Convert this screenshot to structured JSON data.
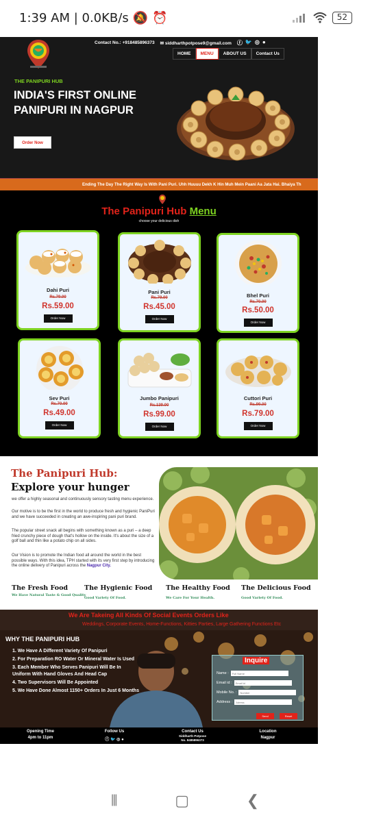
{
  "status": {
    "time": "1:39 AM | 0.0KB/s",
    "battery": "52"
  },
  "header": {
    "contact": "Contact No.: +918485896373",
    "email": "siddharthpotpose9@gmail.com",
    "nav": [
      "HOME",
      "MENU",
      "ABOUT US",
      "Contact Us"
    ]
  },
  "hero": {
    "small": "THE PANIPURI HUB",
    "title": "INDIA'S FIRST ONLINE PANIPURI IN NAGPUR",
    "button": "Order Now"
  },
  "ticker": "Ending The Day The Right Way Is With Pani Puri. Uhh Huuuu Dekh K Hin Muh Mein Paani Aa Jata Hai. Bhaiya Th",
  "menu": {
    "title_a": "The Panipuri Hub",
    "title_b": "Menu",
    "subtitle": "choose your delicious dish",
    "button": "Order Now",
    "items": [
      {
        "name": "Dahi Puri",
        "old": "Rs.79.00",
        "price": "Rs.59.00"
      },
      {
        "name": "Pani Puri",
        "old": "Rs.79.00",
        "price": "Rs.45.00"
      },
      {
        "name": "Bhel Puri",
        "old": "Rs.70.00",
        "price": "Rs.50.00"
      },
      {
        "name": "Sev Puri",
        "old": "Rs.70.00",
        "price": "Rs.49.00"
      },
      {
        "name": "Jumbo Panipuri",
        "old": "Rs.139.00",
        "price": "Rs.99.00"
      },
      {
        "name": "Cuttori Puri",
        "old": "Rs.99.00",
        "price": "Rs.79.00"
      }
    ]
  },
  "explore": {
    "h1": "The Panipuri Hub:",
    "h2": "Explore your hunger",
    "p1": "we offer a highly seasonal and continuously sensory tasting menu experience.",
    "p2": "Our motive is to be the first in the world to produce fresh and hygienic PaniPuri and we have succeeded in creating an awe-inspiring pani puri brand.",
    "p3": "The popular street snack all begins with something known as a puri – a deep fried crunchy piece of dough that's hollow on the inside. It's about the size of a golf ball and thin like a potato chip on all sides.",
    "p4": "Our Vision is to promote the Indian food all around the world in the best possible ways. With this idea, TPH started with its very first step by introducing the online delivery of Panipuri across the",
    "city": "Nagpur City.",
    "features": [
      {
        "t": "The Fresh Food",
        "s": "We Have Natural Taste & Good Quality"
      },
      {
        "t": "The Hygienic Food",
        "s": "Good Variety Of Food."
      },
      {
        "t": "The Healthy Food",
        "s": "We Care For Your Health."
      },
      {
        "t": "The Delicious Food",
        "s": "Good Variety Of Food."
      }
    ]
  },
  "why": {
    "event1": "We Are Takeing All Kinds Of Social Events Orders Like",
    "event2": "Weddings, Corporate Events, Home-Functions, Kitties Parties, Large Gathering Functions Etc",
    "title": "WHY THE PANIPURI HUB",
    "points": [
      "1. We Have A Different Variety Of Panipuri",
      "2. For Preparation RO Water Or Mineral Water Is Used",
      "3. Each Member Who Serves Panipuri Will Be In Uniform With Hand Gloves And Head Cap",
      "4. Two Supervisors Will Be Appointed",
      "5. We Have Done Almost 1150+ Orders In Just 6 Months"
    ],
    "form": {
      "heading": "Inquire",
      "labels": [
        "Name :",
        "Email id :",
        "Mobile No. :",
        "Address :"
      ],
      "placeholders": [
        "Full Name",
        "Email id",
        "Number",
        "Adress"
      ],
      "send": "Send",
      "reset": "Reset"
    }
  },
  "footer": {
    "cols": [
      {
        "h": "Opening Time",
        "v": "4pm to 11pm"
      },
      {
        "h": "Follow Us",
        "v": ""
      },
      {
        "h": "Contact Us",
        "v": "Siddharth Potpose",
        "v2": "No. 8485896373"
      },
      {
        "h": "Location",
        "v": "Nagpur"
      }
    ]
  }
}
